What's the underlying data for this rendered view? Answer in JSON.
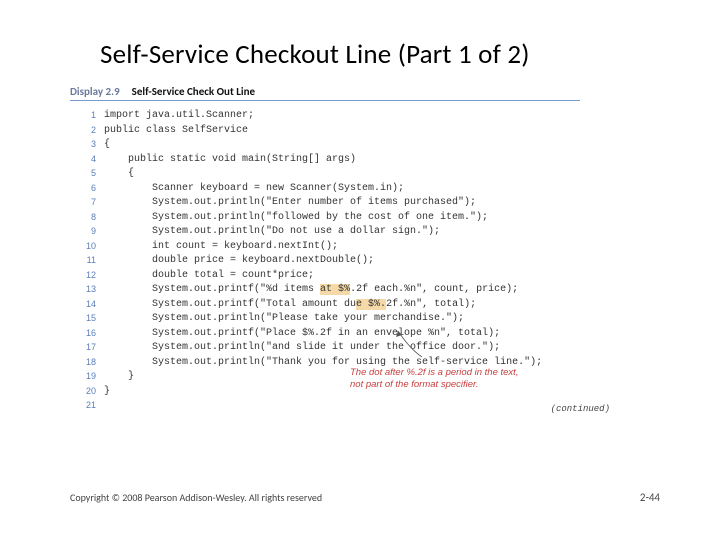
{
  "title": "Self-Service Checkout Line (Part 1 of 2)",
  "display": {
    "number": "Display 2.9",
    "caption": "Self-Service Check Out Line"
  },
  "code": {
    "lines": [
      {
        "n": "1",
        "t": "import java.util.Scanner;"
      },
      {
        "n": "",
        "t": ""
      },
      {
        "n": "2",
        "t": "public class SelfService"
      },
      {
        "n": "3",
        "t": "{"
      },
      {
        "n": "4",
        "t": "    public static void main(String[] args)"
      },
      {
        "n": "5",
        "t": "    {"
      },
      {
        "n": "6",
        "t": "        Scanner keyboard = new Scanner(System.in);"
      },
      {
        "n": "",
        "t": ""
      },
      {
        "n": "7",
        "t": "        System.out.println(\"Enter number of items purchased\");"
      },
      {
        "n": "8",
        "t": "        System.out.println(\"followed by the cost of one item.\");"
      },
      {
        "n": "9",
        "t": "        System.out.println(\"Do not use a dollar sign.\");"
      },
      {
        "n": "",
        "t": ""
      },
      {
        "n": "10",
        "t": "        int count = keyboard.nextInt();"
      },
      {
        "n": "11",
        "t": "        double price = keyboard.nextDouble();"
      },
      {
        "n": "12",
        "t": "        double total = count*price;"
      },
      {
        "n": "",
        "t": ""
      },
      {
        "n": "13",
        "t": "        System.out.printf(\"%d items at $%.2f each.%n\", count, price);",
        "hl": [
          36,
          41
        ]
      },
      {
        "n": "14",
        "t": "        System.out.printf(\"Total amount due $%.2f.%n\", total);",
        "hl": [
          42,
          47
        ]
      },
      {
        "n": "",
        "t": ""
      },
      {
        "n": "15",
        "t": "        System.out.println(\"Please take your merchandise.\");"
      },
      {
        "n": "16",
        "t": "        System.out.printf(\"Place $%.2f in an envelope %n\", total);"
      },
      {
        "n": "17",
        "t": "        System.out.println(\"and slide it under the office door.\");"
      },
      {
        "n": "18",
        "t": "        System.out.println(\"Thank you for using the self-service line.\");"
      },
      {
        "n": "19",
        "t": "    }"
      },
      {
        "n": "20",
        "t": "}"
      },
      {
        "n": "21",
        "t": ""
      }
    ]
  },
  "callout": "The dot after %.2f is a period in the text, not part of the format specifier.",
  "continued": "(continued)",
  "footer": {
    "copyright": "Copyright © 2008 Pearson Addison-Wesley. All rights reserved",
    "page": "2-44"
  }
}
